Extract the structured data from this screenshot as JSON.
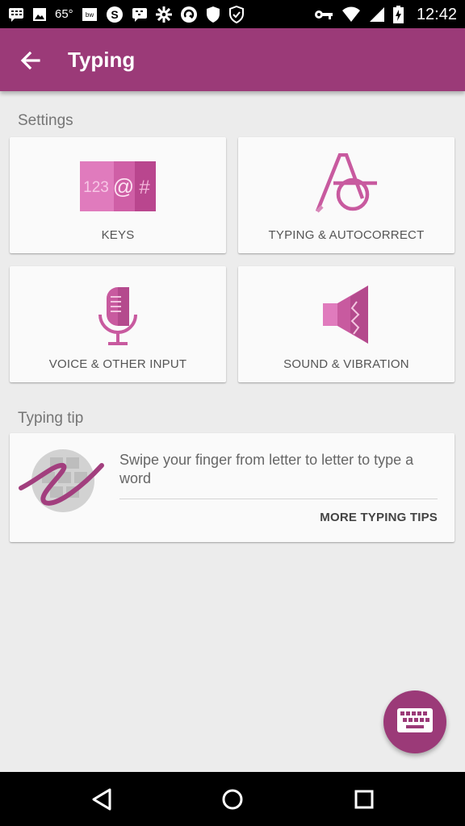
{
  "status_bar": {
    "temperature": "65°",
    "time": "12:42",
    "left_icons": [
      "bbm-icon",
      "image-icon",
      "temperature",
      "weather-channel-icon",
      "skype-icon",
      "bbm-chat-icon",
      "settings-gear-icon",
      "sync-icon",
      "shield-icon",
      "shield-check-icon"
    ],
    "right_icons": [
      "vpn-key-icon",
      "wifi-icon",
      "signal-icon",
      "battery-charging-icon"
    ]
  },
  "app_bar": {
    "title": "Typing",
    "back_icon": "arrow-back-icon",
    "color": "#9b3a78"
  },
  "settings_section": {
    "label": "Settings",
    "tiles": [
      {
        "label": "KEYS",
        "icon": "keys-icon"
      },
      {
        "label": "TYPING & AUTOCORRECT",
        "icon": "autocorrect-icon"
      },
      {
        "label": "VOICE & OTHER INPUT",
        "icon": "microphone-icon"
      },
      {
        "label": "SOUND & VIBRATION",
        "icon": "speaker-vibration-icon"
      }
    ]
  },
  "tip_section": {
    "label": "Typing tip",
    "text": "Swipe your finger from letter to letter to type a word",
    "link": "MORE TYPING TIPS",
    "icon": "swipe-gesture-icon"
  },
  "fab": {
    "icon": "keyboard-icon"
  },
  "nav_bar": {
    "buttons": [
      "back-triangle-icon",
      "home-circle-icon",
      "recents-square-icon"
    ]
  },
  "keys_icon_text": {
    "numbers": "123",
    "at": "@",
    "hash": "#"
  }
}
